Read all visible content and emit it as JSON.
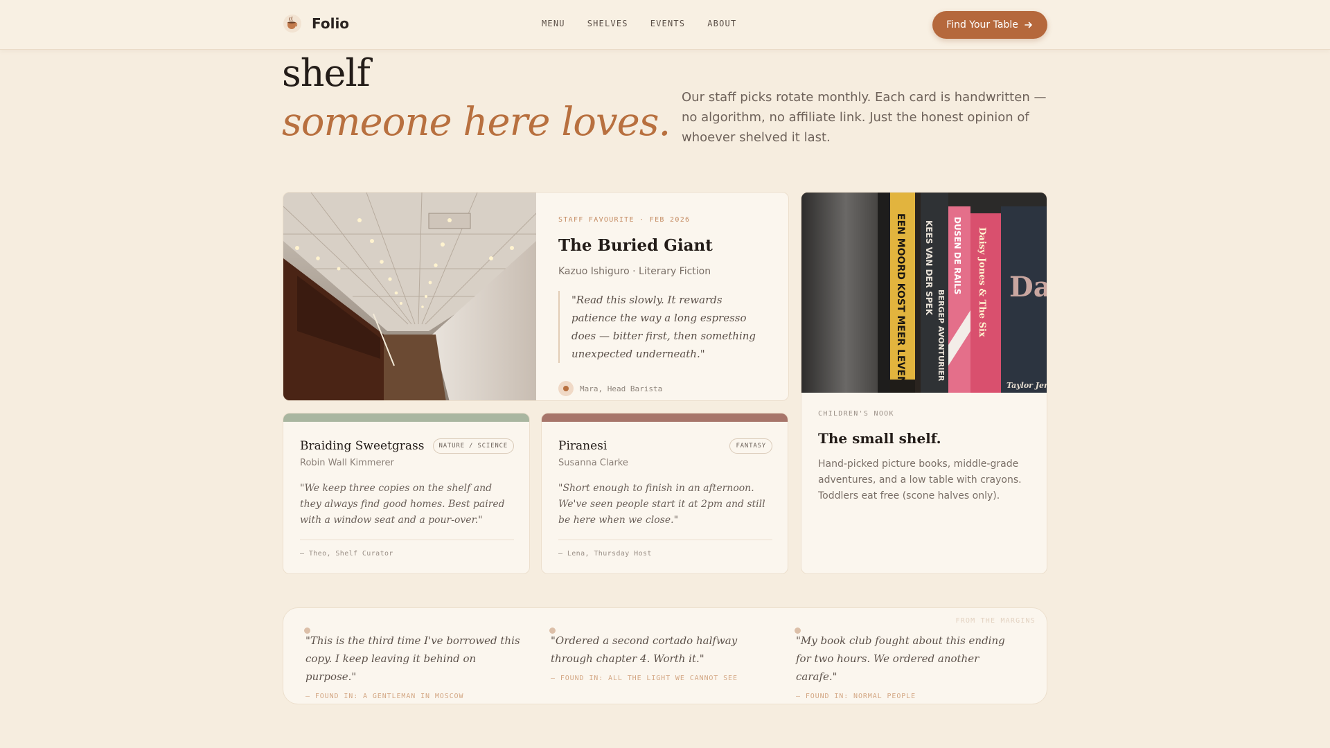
{
  "header": {
    "brand": "Folio",
    "nav": [
      "MENU",
      "SHELVES",
      "EVENTS",
      "ABOUT"
    ],
    "cta_label": "Find Your Table",
    "accent_color": "#b5683c"
  },
  "hero": {
    "line1": "shelf",
    "line2": "someone here loves.",
    "description": "Our staff picks rotate monthly. Each card is handwritten — no algorithm, no affiliate link. Just the honest opinion of whoever shelved it last."
  },
  "featured": {
    "kicker": "STAFF FAVOURITE · FEB 2026",
    "title": "The Buried Giant",
    "meta": "Kazuo Ishiguro · Literary Fiction",
    "quote": "\"Read this slowly. It rewards patience the way a long espresso does — bitter first, then something unexpected underneath.\"",
    "byline": "Mara, Head Barista"
  },
  "picks": [
    {
      "title": "Braiding Sweetgrass",
      "tag": "NATURE / SCIENCE",
      "author": "Robin Wall Kimmerer",
      "quote": "\"We keep three copies on the shelf and they always find good homes. Best paired with a window seat and a pour-over.\"",
      "signature": "— Theo, Shelf Curator",
      "band_color": "#a9b6a0"
    },
    {
      "title": "Piranesi",
      "tag": "FANTASY",
      "author": "Susanna Clarke",
      "quote": "\"Short enough to finish in an afternoon. We've seen people start it at 2pm and still be here when we close.\"",
      "signature": "— Lena, Thursday Host",
      "band_color": "#a7756a"
    }
  ],
  "nook": {
    "kicker": "CHILDREN'S NOOK",
    "title": "The small shelf.",
    "text": "Hand-picked picture books, middle-grade adventures, and a low table with crayons. Toddlers eat free (scone halves only)."
  },
  "margins": {
    "label": "FROM THE MARGINS",
    "quotes": [
      {
        "text": "\"This is the third time I've borrowed this copy. I keep leaving it behind on purpose.\"",
        "source": "— FOUND IN: A GENTLEMAN IN MOSCOW"
      },
      {
        "text": "\"Ordered a second cortado halfway through chapter 4. Worth it.\"",
        "source": "— FOUND IN: ALL THE LIGHT WE CANNOT SEE"
      },
      {
        "text": "\"My book club fought about this ending for two hours. We ordered another carafe.\"",
        "source": "— FOUND IN: NORMAL PEOPLE"
      }
    ]
  },
  "book_spines": [
    "EEN MOORD KOST MEER LEVENS",
    "KEES VAN DER SPEK",
    "BERGEP AVONTURIER",
    "DUSEN DE RAILS",
    "Daisy Jones & The Six",
    "Da Jo & Th",
    "Taylor Jen"
  ]
}
